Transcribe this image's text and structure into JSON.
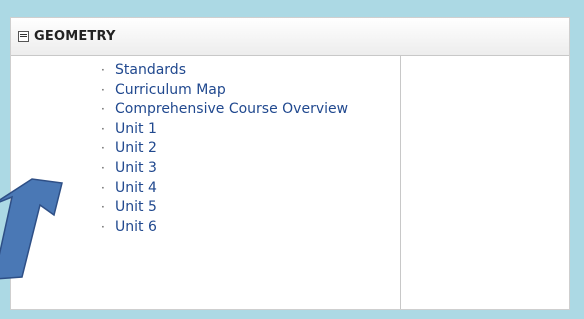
{
  "panel": {
    "title": "GEOMETRY",
    "links": [
      "Standards",
      "Curriculum Map",
      "Comprehensive Course Overview",
      "Unit 1",
      "Unit 2",
      "Unit 3",
      "Unit 4",
      "Unit 5",
      "Unit 6"
    ]
  },
  "colors": {
    "background": "#acd9e4",
    "link": "#21498f",
    "arrow_fill": "#4a78b5",
    "arrow_stroke": "#2e4f86"
  },
  "icons": {
    "header": "collapse-icon",
    "pointer": "arrow-icon"
  }
}
